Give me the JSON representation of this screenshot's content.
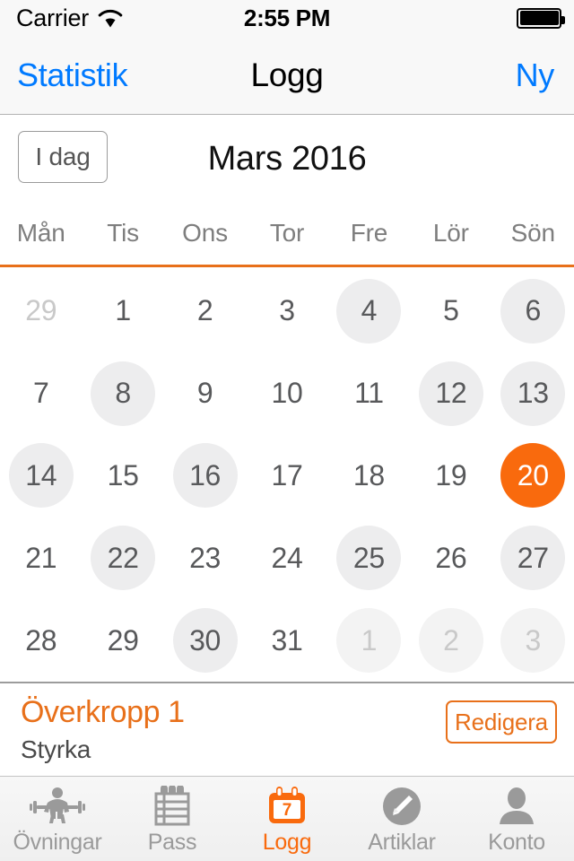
{
  "status_bar": {
    "carrier": "Carrier",
    "wifi_icon": "wifi-icon",
    "time": "2:55 PM",
    "battery_icon": "battery-full-icon"
  },
  "nav_bar": {
    "left_label": "Statistik",
    "title": "Logg",
    "right_label": "Ny",
    "tint_color": "#007AFF"
  },
  "month_header": {
    "today_button": "I dag",
    "month_title": "Mars 2016"
  },
  "weekdays": [
    "Mån",
    "Tis",
    "Ons",
    "Tor",
    "Fre",
    "Lör",
    "Sön"
  ],
  "calendar": {
    "accent_color": "#F96A0D",
    "separator_color": "#E8701A",
    "marker_color": "#EDEDEE",
    "selected_day": "20",
    "days": [
      {
        "label": "29",
        "month": "other",
        "marked": false,
        "selected": false
      },
      {
        "label": "1",
        "month": "current",
        "marked": false,
        "selected": false
      },
      {
        "label": "2",
        "month": "current",
        "marked": false,
        "selected": false
      },
      {
        "label": "3",
        "month": "current",
        "marked": false,
        "selected": false
      },
      {
        "label": "4",
        "month": "current",
        "marked": true,
        "selected": false
      },
      {
        "label": "5",
        "month": "current",
        "marked": false,
        "selected": false
      },
      {
        "label": "6",
        "month": "current",
        "marked": true,
        "selected": false
      },
      {
        "label": "7",
        "month": "current",
        "marked": false,
        "selected": false
      },
      {
        "label": "8",
        "month": "current",
        "marked": true,
        "selected": false
      },
      {
        "label": "9",
        "month": "current",
        "marked": false,
        "selected": false
      },
      {
        "label": "10",
        "month": "current",
        "marked": false,
        "selected": false
      },
      {
        "label": "11",
        "month": "current",
        "marked": false,
        "selected": false
      },
      {
        "label": "12",
        "month": "current",
        "marked": true,
        "selected": false
      },
      {
        "label": "13",
        "month": "current",
        "marked": true,
        "selected": false
      },
      {
        "label": "14",
        "month": "current",
        "marked": true,
        "selected": false
      },
      {
        "label": "15",
        "month": "current",
        "marked": false,
        "selected": false
      },
      {
        "label": "16",
        "month": "current",
        "marked": true,
        "selected": false
      },
      {
        "label": "17",
        "month": "current",
        "marked": false,
        "selected": false
      },
      {
        "label": "18",
        "month": "current",
        "marked": false,
        "selected": false
      },
      {
        "label": "19",
        "month": "current",
        "marked": false,
        "selected": false
      },
      {
        "label": "20",
        "month": "current",
        "marked": true,
        "selected": true
      },
      {
        "label": "21",
        "month": "current",
        "marked": false,
        "selected": false
      },
      {
        "label": "22",
        "month": "current",
        "marked": true,
        "selected": false
      },
      {
        "label": "23",
        "month": "current",
        "marked": false,
        "selected": false
      },
      {
        "label": "24",
        "month": "current",
        "marked": false,
        "selected": false
      },
      {
        "label": "25",
        "month": "current",
        "marked": true,
        "selected": false
      },
      {
        "label": "26",
        "month": "current",
        "marked": false,
        "selected": false
      },
      {
        "label": "27",
        "month": "current",
        "marked": true,
        "selected": false
      },
      {
        "label": "28",
        "month": "current",
        "marked": false,
        "selected": false
      },
      {
        "label": "29",
        "month": "current",
        "marked": false,
        "selected": false
      },
      {
        "label": "30",
        "month": "current",
        "marked": true,
        "selected": false
      },
      {
        "label": "31",
        "month": "current",
        "marked": false,
        "selected": false
      },
      {
        "label": "1",
        "month": "other",
        "marked": true,
        "selected": false
      },
      {
        "label": "2",
        "month": "other",
        "marked": true,
        "selected": false
      },
      {
        "label": "3",
        "month": "other",
        "marked": true,
        "selected": false
      }
    ]
  },
  "workout": {
    "title": "Överkropp 1",
    "subtitle": "Styrka",
    "edit_button": "Redigera",
    "color": "#E8701A"
  },
  "tab_bar": {
    "active_index": 2,
    "active_color": "#F96A0D",
    "inactive_color": "#9A9A9A",
    "items": [
      {
        "label": "Övningar",
        "icon": "weightlifter-icon"
      },
      {
        "label": "Pass",
        "icon": "notepad-icon"
      },
      {
        "label": "Logg",
        "icon": "calendar-icon",
        "icon_day": "7"
      },
      {
        "label": "Artiklar",
        "icon": "pencil-circle-icon"
      },
      {
        "label": "Konto",
        "icon": "person-icon"
      }
    ]
  }
}
